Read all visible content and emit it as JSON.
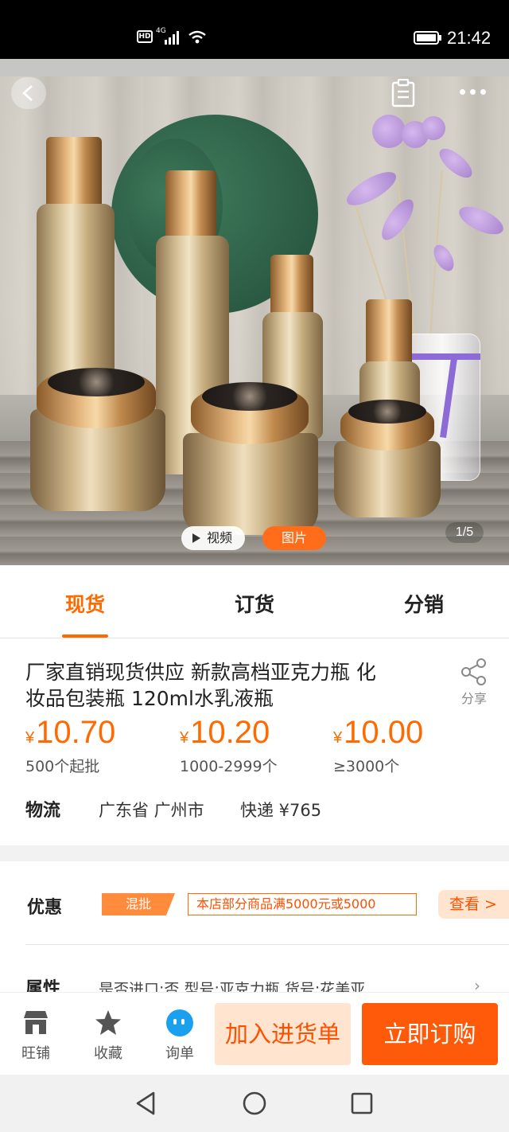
{
  "status_bar": {
    "time": "21:42",
    "hd": "HD",
    "network": "4G"
  },
  "gallery": {
    "video_label": "视频",
    "image_label": "图片",
    "page_indicator": "1/5"
  },
  "tabs": [
    {
      "label": "现货",
      "active": true
    },
    {
      "label": "订货",
      "active": false
    },
    {
      "label": "分销",
      "active": false
    }
  ],
  "product": {
    "title_line1": "厂家直销现货供应 新款高档亚克力瓶 化",
    "title_line2": "妆品包装瓶 120ml水乳液瓶",
    "share_label": "分享",
    "currency": "¥",
    "prices": [
      {
        "value": "10.70",
        "qty": "500个起批"
      },
      {
        "value": "10.20",
        "qty": "1000-2999个"
      },
      {
        "value": "10.00",
        "qty": "≥3000个"
      }
    ],
    "logistics_label": "物流",
    "logistics_location": "广东省 广州市",
    "logistics_shipping": "快递 ¥765"
  },
  "promo": {
    "label": "优惠",
    "badge": "混批",
    "text": "本店部分商品满5000元或5000",
    "view_label": "查看 >"
  },
  "attributes": {
    "label": "属性",
    "text": "是否进口:否  型号:亚克力瓶  货号:花美亚",
    "arrow": "›"
  },
  "action_bar": {
    "shop_label": "旺铺",
    "fav_label": "收藏",
    "inquiry_label": "询单",
    "cart_label": "加入进货单",
    "buy_label": "立即订购"
  },
  "colors": {
    "accent": "#ff6a00",
    "buy": "#ff5a0a",
    "cart_bg": "#ffe4cf"
  }
}
